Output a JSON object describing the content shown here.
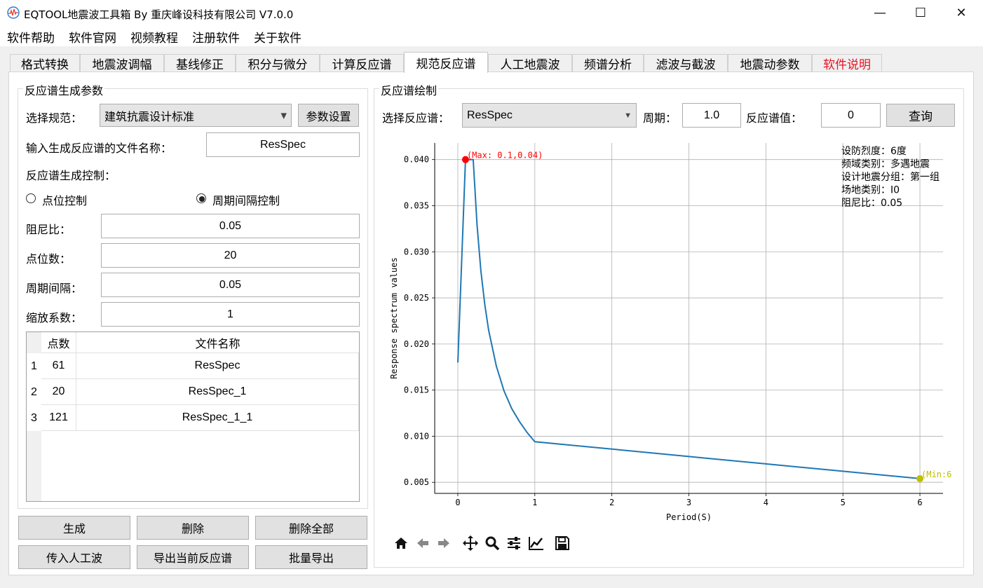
{
  "window": {
    "title": "EQTOOL地震波工具箱 By 重庆峰设科技有限公司  V7.0.0",
    "minimize_glyph": "—",
    "maximize_glyph": "☐",
    "close_glyph": "✕"
  },
  "menu": [
    "软件帮助",
    "软件官网",
    "视频教程",
    "注册软件",
    "关于软件"
  ],
  "tabs": [
    "格式转换",
    "地震波调幅",
    "基线修正",
    "积分与微分",
    "计算反应谱",
    "规范反应谱",
    "人工地震波",
    "频谱分析",
    "滤波与截波",
    "地震动参数",
    "软件说明"
  ],
  "active_tab": "规范反应谱",
  "colors": {
    "highlight_tab_text": "#e81123",
    "curve": "#1f77b4",
    "max_marker": "#ff0000",
    "min_marker": "#bfbf00"
  },
  "left": {
    "group_title": "反应谱生成参数",
    "standard_label": "选择规范：",
    "standard_value": "建筑抗震设计标准",
    "param_button": "参数设置",
    "filename_label": "输入生成反应谱的文件名称：",
    "filename_value": "ResSpec",
    "control_label": "反应谱生成控制：",
    "radio_point": "点位控制",
    "radio_interval": "周期间隔控制",
    "damping_label": "阻尼比：",
    "damping_value": "0.05",
    "points_label": "点位数：",
    "points_value": "20",
    "interval_label": "周期间隔：",
    "interval_value": "0.05",
    "scale_label": "缩放系数：",
    "scale_value": "1",
    "table": {
      "headers": [
        "点数",
        "文件名称"
      ],
      "rows": [
        {
          "index": "1",
          "points": "61",
          "name": "ResSpec"
        },
        {
          "index": "2",
          "points": "20",
          "name": "ResSpec_1"
        },
        {
          "index": "3",
          "points": "121",
          "name": "ResSpec_1_1"
        }
      ]
    },
    "buttons": [
      "生成",
      "删除",
      "删除全部",
      "传入人工波",
      "导出当前反应谱",
      "批量导出"
    ]
  },
  "right": {
    "group_title": "反应谱绘制",
    "select_label": "选择反应谱：",
    "select_value": "ResSpec",
    "period_label": "周期：",
    "period_value": "1.0",
    "value_label": "反应谱值：",
    "value_value": "0",
    "query_button": "查询",
    "toolbar_icons": [
      "home-icon",
      "back-icon",
      "forward-icon",
      "pan-icon",
      "zoom-icon",
      "configure-icon",
      "edit-axis-icon",
      "save-icon"
    ]
  },
  "chart_data": {
    "type": "line",
    "xlabel": "Period(S)",
    "ylabel": "Response spectrum values",
    "xlim": [
      -0.3,
      6.3
    ],
    "ylim": [
      0.0038,
      0.0418
    ],
    "xticks": [
      "0",
      "1",
      "2",
      "3",
      "4",
      "5",
      "6"
    ],
    "yticks": [
      "0.005",
      "0.010",
      "0.015",
      "0.020",
      "0.025",
      "0.030",
      "0.035",
      "0.040"
    ],
    "grid": true,
    "series": [
      {
        "x": [
          0,
          0.1,
          0.15,
          0.2,
          0.25,
          0.3,
          0.35,
          0.4,
          0.5,
          0.6,
          0.7,
          0.8,
          0.9,
          1.0,
          2.0,
          3.0,
          4.0,
          5.0,
          6.0
        ],
        "y": [
          0.018,
          0.04,
          0.04,
          0.04,
          0.0329,
          0.0279,
          0.0243,
          0.0215,
          0.0176,
          0.0149,
          0.013,
          0.0116,
          0.0104,
          0.0094,
          0.0086,
          0.0078,
          0.007,
          0.0062,
          0.0054
        ]
      }
    ],
    "max_point": {
      "x": 0.1,
      "y": 0.04,
      "label": "(Max: 0.1,0.04)"
    },
    "min_point": {
      "x": 6,
      "y": 0.0054,
      "label": "(Min:6"
    },
    "annotation_lines": [
      "设防烈度：6度",
      "频域类别：多遇地震",
      "设计地震分组：第一组",
      "场地类别：I0",
      "阻尼比：0.05"
    ]
  }
}
